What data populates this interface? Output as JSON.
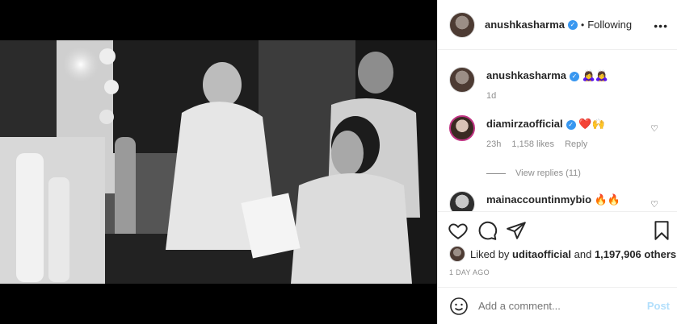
{
  "header": {
    "username": "anushkasharma",
    "follow_state": "Following"
  },
  "caption": {
    "username": "anushkasharma",
    "text": "🙇‍♀️🙇‍♀️",
    "time": "1d"
  },
  "comments": [
    {
      "username": "diamirzaofficial",
      "text": "❤️🙌",
      "time": "23h",
      "likes": "1,158 likes",
      "reply_label": "Reply",
      "view_replies": "View replies (11)"
    },
    {
      "username": "mainaccountinmybio",
      "text": "🔥🔥"
    }
  ],
  "likes": {
    "prefix": "Liked by",
    "user": "uditaofficial",
    "conjunction": "and",
    "count": "1,197,906 others"
  },
  "timestamp": "1 DAY AGO",
  "comment_box": {
    "placeholder": "Add a comment...",
    "post_label": "Post"
  },
  "icons": {
    "verified": "verified-badge-icon",
    "like": "heart-icon",
    "comment": "comment-icon",
    "share": "paper-plane-icon",
    "save": "bookmark-icon",
    "emoji": "smiley-icon",
    "more": "more-options-icon"
  },
  "colors": {
    "verified_blue": "#3897f0",
    "post_disabled": "#b2dffc",
    "heart_red": "#ed4956"
  }
}
